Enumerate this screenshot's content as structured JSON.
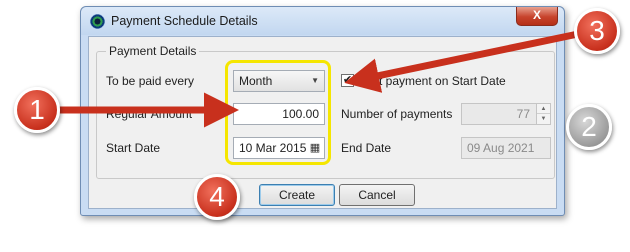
{
  "window": {
    "title": "Payment Schedule Details",
    "close_label": "X"
  },
  "group": {
    "legend": "Payment Details"
  },
  "form": {
    "paid_every_label": "To be paid every",
    "paid_every_value": "Month",
    "first_payment_label": "First payment on Start Date",
    "first_payment_checked": true,
    "regular_amount_label": "Regular Amount",
    "regular_amount_value": "100.00",
    "num_payments_label": "Number of payments",
    "num_payments_value": "77",
    "start_date_label": "Start Date",
    "start_date_value": "10 Mar 2015",
    "end_date_label": "End Date",
    "end_date_value": "09 Aug 2021"
  },
  "buttons": {
    "create_label": "Create",
    "cancel_label": "Cancel"
  },
  "annotations": {
    "badge_1": "1",
    "badge_2": "2",
    "badge_3": "3",
    "badge_4": "4",
    "highlight_color": "#f5e600",
    "arrow_color": "#c8301d"
  },
  "icons": {
    "combo_arrow": "chevron-down-icon",
    "checkmark": "checkmark-icon",
    "calendar": "calendar-icon",
    "spin": "spin-up-down-icon"
  }
}
